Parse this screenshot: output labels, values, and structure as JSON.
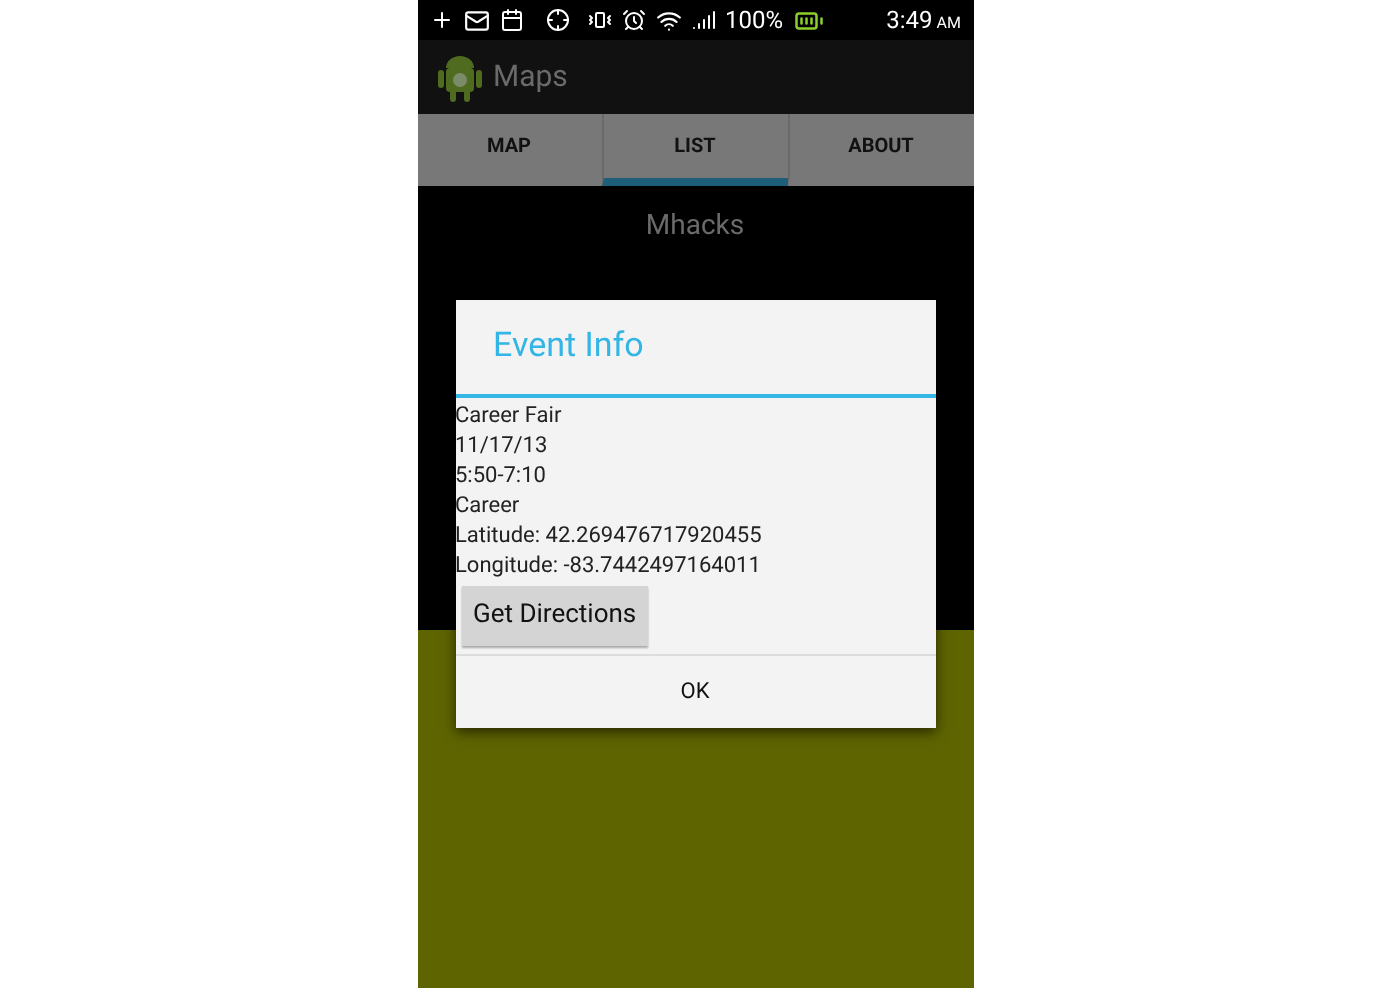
{
  "status_bar": {
    "battery": "100%",
    "time": "3:49",
    "meridiem": "AM"
  },
  "action_bar": {
    "title": "Maps"
  },
  "tabs": [
    {
      "label": "MAP",
      "selected": false
    },
    {
      "label": "LIST",
      "selected": true
    },
    {
      "label": "ABOUT",
      "selected": false
    }
  ],
  "list": {
    "items": [
      "Mhacks"
    ]
  },
  "dialog": {
    "title": "Event Info",
    "lines": [
      "Career Fair",
      "11/17/13",
      "5:50-7:10",
      "Career",
      "Latitude: 42.269476717920455",
      "Longitude: -83.7442497164011"
    ],
    "action_button": "Get Directions",
    "ok_button": "OK"
  }
}
